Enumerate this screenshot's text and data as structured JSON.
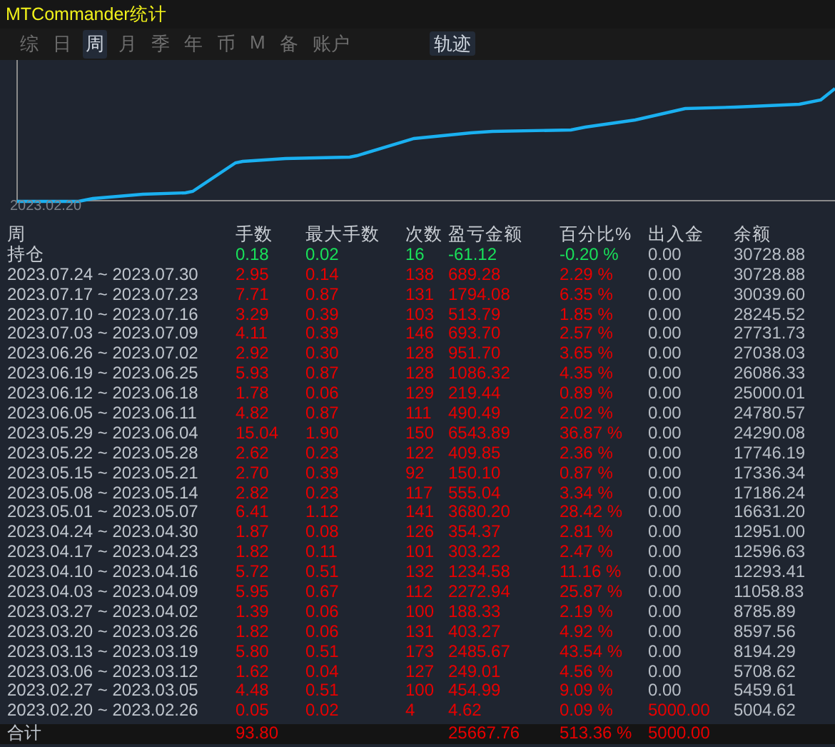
{
  "window": {
    "title": "MTCommander统计"
  },
  "tabs": [
    {
      "label": "综",
      "selected": false
    },
    {
      "label": "日",
      "selected": false
    },
    {
      "label": "周",
      "selected": true
    },
    {
      "label": "月",
      "selected": false
    },
    {
      "label": "季",
      "selected": false
    },
    {
      "label": "年",
      "selected": false
    },
    {
      "label": "币",
      "selected": false
    },
    {
      "label": "M",
      "selected": false
    },
    {
      "label": "备",
      "selected": false
    },
    {
      "label": "账户",
      "selected": false
    }
  ],
  "track_toggle": {
    "label": "轨迹",
    "on": true
  },
  "chart": {
    "start_label": "2023.02.20"
  },
  "table": {
    "columns": [
      "周",
      "手数",
      "最大手数",
      "次数",
      "盈亏金额",
      "百分比%",
      "出入金",
      "余额"
    ],
    "rows": [
      {
        "kind": "position",
        "period": "持仓",
        "lots": "0.18",
        "max_lots": "0.02",
        "trades": "16",
        "pnl": "-61.12",
        "percent": "-0.20 %",
        "deposit": "0.00",
        "balance": "30728.88"
      },
      {
        "kind": "week",
        "period": "2023.07.24 ~ 2023.07.30",
        "lots": "2.95",
        "max_lots": "0.14",
        "trades": "138",
        "pnl": "689.28",
        "percent": "2.29 %",
        "deposit": "0.00",
        "balance": "30728.88",
        "deposit_flag": false
      },
      {
        "kind": "week",
        "period": "2023.07.17 ~ 2023.07.23",
        "lots": "7.71",
        "max_lots": "0.87",
        "trades": "131",
        "pnl": "1794.08",
        "percent": "6.35 %",
        "deposit": "0.00",
        "balance": "30039.60",
        "deposit_flag": false
      },
      {
        "kind": "week",
        "period": "2023.07.10 ~ 2023.07.16",
        "lots": "3.29",
        "max_lots": "0.39",
        "trades": "103",
        "pnl": "513.79",
        "percent": "1.85 %",
        "deposit": "0.00",
        "balance": "28245.52",
        "deposit_flag": false
      },
      {
        "kind": "week",
        "period": "2023.07.03 ~ 2023.07.09",
        "lots": "4.11",
        "max_lots": "0.39",
        "trades": "146",
        "pnl": "693.70",
        "percent": "2.57 %",
        "deposit": "0.00",
        "balance": "27731.73",
        "deposit_flag": false
      },
      {
        "kind": "week",
        "period": "2023.06.26 ~ 2023.07.02",
        "lots": "2.92",
        "max_lots": "0.30",
        "trades": "128",
        "pnl": "951.70",
        "percent": "3.65 %",
        "deposit": "0.00",
        "balance": "27038.03",
        "deposit_flag": false
      },
      {
        "kind": "week",
        "period": "2023.06.19 ~ 2023.06.25",
        "lots": "5.93",
        "max_lots": "0.87",
        "trades": "128",
        "pnl": "1086.32",
        "percent": "4.35 %",
        "deposit": "0.00",
        "balance": "26086.33",
        "deposit_flag": false
      },
      {
        "kind": "week",
        "period": "2023.06.12 ~ 2023.06.18",
        "lots": "1.78",
        "max_lots": "0.06",
        "trades": "129",
        "pnl": "219.44",
        "percent": "0.89 %",
        "deposit": "0.00",
        "balance": "25000.01",
        "deposit_flag": false
      },
      {
        "kind": "week",
        "period": "2023.06.05 ~ 2023.06.11",
        "lots": "4.82",
        "max_lots": "0.87",
        "trades": "111",
        "pnl": "490.49",
        "percent": "2.02 %",
        "deposit": "0.00",
        "balance": "24780.57",
        "deposit_flag": false
      },
      {
        "kind": "week",
        "period": "2023.05.29 ~ 2023.06.04",
        "lots": "15.04",
        "max_lots": "1.90",
        "trades": "150",
        "pnl": "6543.89",
        "percent": "36.87 %",
        "deposit": "0.00",
        "balance": "24290.08",
        "deposit_flag": false
      },
      {
        "kind": "week",
        "period": "2023.05.22 ~ 2023.05.28",
        "lots": "2.62",
        "max_lots": "0.23",
        "trades": "122",
        "pnl": "409.85",
        "percent": "2.36 %",
        "deposit": "0.00",
        "balance": "17746.19",
        "deposit_flag": false
      },
      {
        "kind": "week",
        "period": "2023.05.15 ~ 2023.05.21",
        "lots": "2.70",
        "max_lots": "0.39",
        "trades": "92",
        "pnl": "150.10",
        "percent": "0.87 %",
        "deposit": "0.00",
        "balance": "17336.34",
        "deposit_flag": false
      },
      {
        "kind": "week",
        "period": "2023.05.08 ~ 2023.05.14",
        "lots": "2.82",
        "max_lots": "0.23",
        "trades": "117",
        "pnl": "555.04",
        "percent": "3.34 %",
        "deposit": "0.00",
        "balance": "17186.24",
        "deposit_flag": false
      },
      {
        "kind": "week",
        "period": "2023.05.01 ~ 2023.05.07",
        "lots": "6.41",
        "max_lots": "1.12",
        "trades": "141",
        "pnl": "3680.20",
        "percent": "28.42 %",
        "deposit": "0.00",
        "balance": "16631.20",
        "deposit_flag": false
      },
      {
        "kind": "week",
        "period": "2023.04.24 ~ 2023.04.30",
        "lots": "1.87",
        "max_lots": "0.08",
        "trades": "126",
        "pnl": "354.37",
        "percent": "2.81 %",
        "deposit": "0.00",
        "balance": "12951.00",
        "deposit_flag": false
      },
      {
        "kind": "week",
        "period": "2023.04.17 ~ 2023.04.23",
        "lots": "1.82",
        "max_lots": "0.11",
        "trades": "101",
        "pnl": "303.22",
        "percent": "2.47 %",
        "deposit": "0.00",
        "balance": "12596.63",
        "deposit_flag": false
      },
      {
        "kind": "week",
        "period": "2023.04.10 ~ 2023.04.16",
        "lots": "5.72",
        "max_lots": "0.51",
        "trades": "132",
        "pnl": "1234.58",
        "percent": "11.16 %",
        "deposit": "0.00",
        "balance": "12293.41",
        "deposit_flag": false
      },
      {
        "kind": "week",
        "period": "2023.04.03 ~ 2023.04.09",
        "lots": "5.95",
        "max_lots": "0.67",
        "trades": "112",
        "pnl": "2272.94",
        "percent": "25.87 %",
        "deposit": "0.00",
        "balance": "11058.83",
        "deposit_flag": false
      },
      {
        "kind": "week",
        "period": "2023.03.27 ~ 2023.04.02",
        "lots": "1.39",
        "max_lots": "0.06",
        "trades": "100",
        "pnl": "188.33",
        "percent": "2.19 %",
        "deposit": "0.00",
        "balance": "8785.89",
        "deposit_flag": false
      },
      {
        "kind": "week",
        "period": "2023.03.20 ~ 2023.03.26",
        "lots": "1.82",
        "max_lots": "0.06",
        "trades": "131",
        "pnl": "403.27",
        "percent": "4.92 %",
        "deposit": "0.00",
        "balance": "8597.56",
        "deposit_flag": false
      },
      {
        "kind": "week",
        "period": "2023.03.13 ~ 2023.03.19",
        "lots": "5.80",
        "max_lots": "0.51",
        "trades": "173",
        "pnl": "2485.67",
        "percent": "43.54 %",
        "deposit": "0.00",
        "balance": "8194.29",
        "deposit_flag": false
      },
      {
        "kind": "week",
        "period": "2023.03.06 ~ 2023.03.12",
        "lots": "1.62",
        "max_lots": "0.04",
        "trades": "127",
        "pnl": "249.01",
        "percent": "4.56 %",
        "deposit": "0.00",
        "balance": "5708.62",
        "deposit_flag": false
      },
      {
        "kind": "week",
        "period": "2023.02.27 ~ 2023.03.05",
        "lots": "4.48",
        "max_lots": "0.51",
        "trades": "100",
        "pnl": "454.99",
        "percent": "9.09 %",
        "deposit": "0.00",
        "balance": "5459.61",
        "deposit_flag": false
      },
      {
        "kind": "week",
        "period": "2023.02.20 ~ 2023.02.26",
        "lots": "0.05",
        "max_lots": "0.02",
        "trades": "4",
        "pnl": "4.62",
        "percent": "0.09 %",
        "deposit": "5000.00",
        "balance": "5004.62",
        "deposit_flag": true
      },
      {
        "kind": "total",
        "period": "合计",
        "lots": "93.80",
        "pnl": "25667.76",
        "percent": "513.36 %",
        "deposit": "5000.00"
      }
    ]
  }
}
